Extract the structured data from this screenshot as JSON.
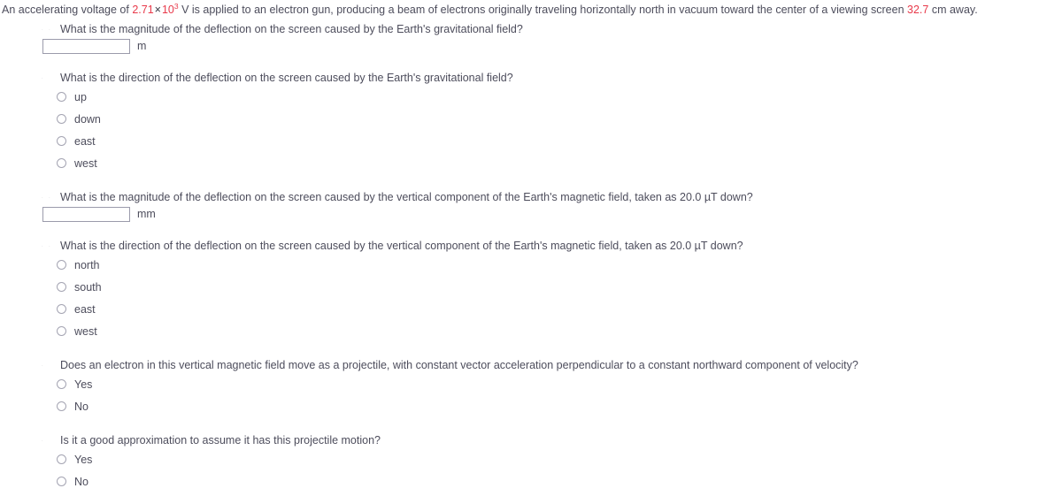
{
  "problem": {
    "lead_1": "An accelerating voltage of ",
    "voltage_value": "2.71",
    "times_symbol": "×",
    "power_base": "10",
    "power_exponent": "3",
    "lead_2": " V is applied to an electron gun, producing a beam of electrons originally traveling horizontally north in vacuum toward the center of a viewing screen ",
    "distance_value": "32.7",
    "lead_3": " cm away.",
    "accent_color": "#e8394a",
    "text_color": "#4d4d5c"
  },
  "parts": [
    {
      "marker": "· ·",
      "question": "What is the magnitude of the deflection on the screen caused by the Earth's gravitational field?",
      "type": "numeric",
      "value": "",
      "placeholder": "",
      "unit": "m"
    },
    {
      "marker": "·",
      "question": "What is the direction of the deflection on the screen caused by the Earth's gravitational field?",
      "type": "radio",
      "options": [
        "up",
        "down",
        "east",
        "west"
      ],
      "selected": null
    },
    {
      "marker": "· ·",
      "question": "What is the magnitude of the deflection on the screen caused by the vertical component of the Earth's magnetic field, taken as 20.0 µT down?",
      "type": "numeric",
      "value": "",
      "placeholder": "",
      "unit": "mm"
    },
    {
      "marker": "· ·",
      "question": "What is the direction of the deflection on the screen caused by the vertical component of the Earth's magnetic field, taken as 20.0 µT down?",
      "type": "radio",
      "options": [
        "north",
        "south",
        "east",
        "west"
      ],
      "selected": null
    },
    {
      "marker": "·",
      "question": "Does an electron in this vertical magnetic field move as a projectile, with constant vector acceleration perpendicular to a constant northward component of velocity?",
      "type": "radio",
      "options": [
        "Yes",
        "No"
      ],
      "selected": null
    },
    {
      "marker": "·",
      "question": "Is it a good approximation to assume it has this projectile motion?",
      "type": "radio",
      "options": [
        "Yes",
        "No"
      ],
      "selected": null
    }
  ]
}
